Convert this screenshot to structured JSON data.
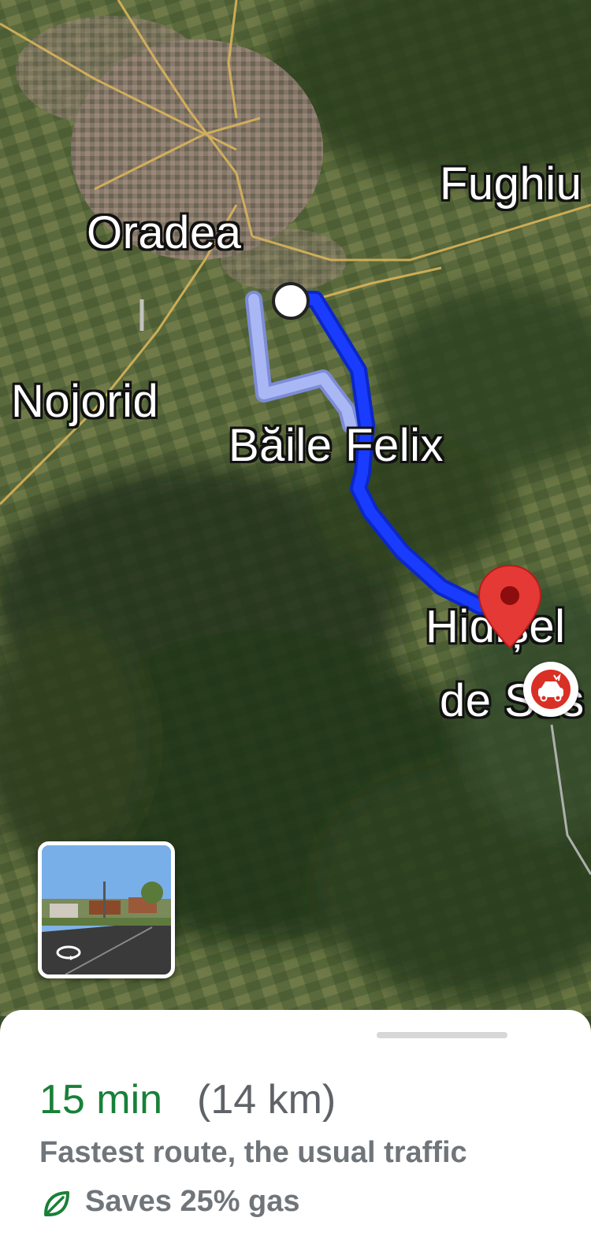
{
  "map": {
    "places": {
      "oradea": "Oradea",
      "fughiu": "Fughiu",
      "nojorid": "Nojorid",
      "baile_felix": "Băile Felix",
      "hidisel_line1": "Hidișel",
      "hidisel_line2": "de Sus"
    },
    "route_color": "#1a3cff",
    "alt_route_color": "#a9b8f5",
    "destination_pin_color": "#e53935",
    "incident_icon": "car-crash-icon",
    "streetview_icon": "rotate-360-icon"
  },
  "route_sheet": {
    "duration": "15 min",
    "distance": "(14 km)",
    "description": "Fastest route, the usual traffic",
    "eco_icon": "leaf-icon",
    "eco_text": "Saves 25% gas",
    "accent_color": "#188038"
  }
}
